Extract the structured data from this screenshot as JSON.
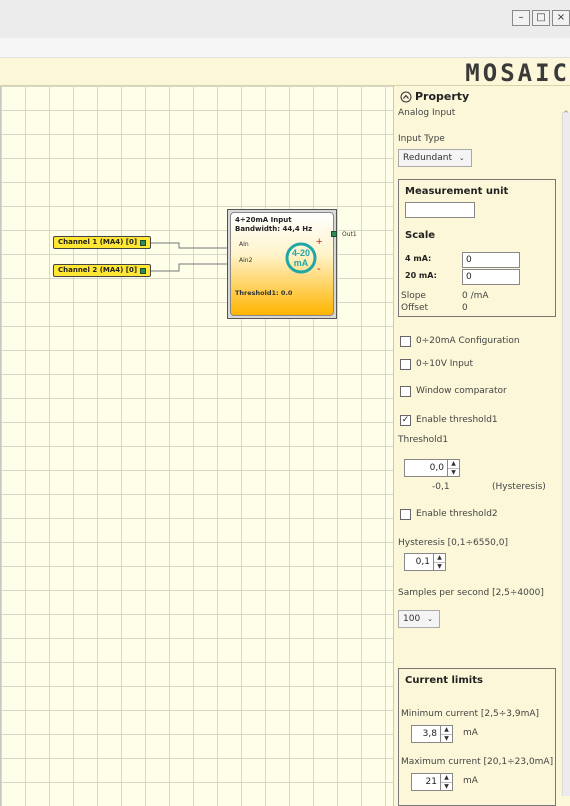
{
  "window": {
    "buttons": {
      "minimize": "–",
      "maximize": "□",
      "close": "×"
    },
    "logo": "MOSAIC"
  },
  "canvas": {
    "channel1_label": "Channel 1 (MA4) [0]",
    "channel2_label": "Channel 2 (MA4) [0]",
    "block": {
      "title_line1": "4÷20mA Input",
      "title_line2": "Bandwidth: 44,4 Hz",
      "port_ain": "AIn",
      "port_ain2": "Ain2",
      "icon_line1": "4-20",
      "icon_line2": "mA",
      "out": "Out1",
      "threshold": "Threshold1: 0.0"
    }
  },
  "panel": {
    "header": "Property",
    "subheader": "Analog Input",
    "input_type_label": "Input Type",
    "input_type_value": "Redundant",
    "measurement": {
      "title": "Measurement unit",
      "unit_value": "",
      "scale_title": "Scale",
      "label_4ma": "4 mA:",
      "value_4ma": "0",
      "label_20ma": "20 mA:",
      "value_20ma": "0",
      "slope_label": "Slope",
      "slope_value": "0 /mA",
      "offset_label": "Offset",
      "offset_value": "0"
    },
    "options": {
      "cfg_0_20": "0÷20mA Configuration",
      "cfg_0_10v": "0÷10V Input",
      "window_comparator": "Window comparator",
      "enable_threshold1": "Enable threshold1",
      "threshold1_label": "Threshold1",
      "threshold1_value": "0,0",
      "hysteresis_value": "-0,1",
      "hysteresis_label": "(Hysteresis)",
      "enable_threshold2": "Enable threshold2",
      "hysteresis_range_label": "Hysteresis [0,1÷6550,0]",
      "hysteresis_range_value": "0,1",
      "samples_label": "Samples per second [2,5÷4000]",
      "samples_value": "100"
    },
    "current_limits": {
      "title": "Current limits",
      "min_label": "Minimum current [2,5÷3,9mA]",
      "min_value": "3,8",
      "min_unit": "mA",
      "max_label": "Maximum current [20,1÷23,0mA]",
      "max_value": "21",
      "max_unit": "mA"
    }
  },
  "colors": {
    "panel_bg": "#fbf7d8",
    "canvas_bg": "#fffee8",
    "channel_fill": "#ffe733",
    "block_gradient_end": "#ffb400",
    "connector_red": "#cc2222"
  },
  "checkbox_states": {
    "cfg_0_20": false,
    "cfg_0_10v": false,
    "window_comparator": false,
    "enable_threshold1": true,
    "enable_threshold2": false
  }
}
